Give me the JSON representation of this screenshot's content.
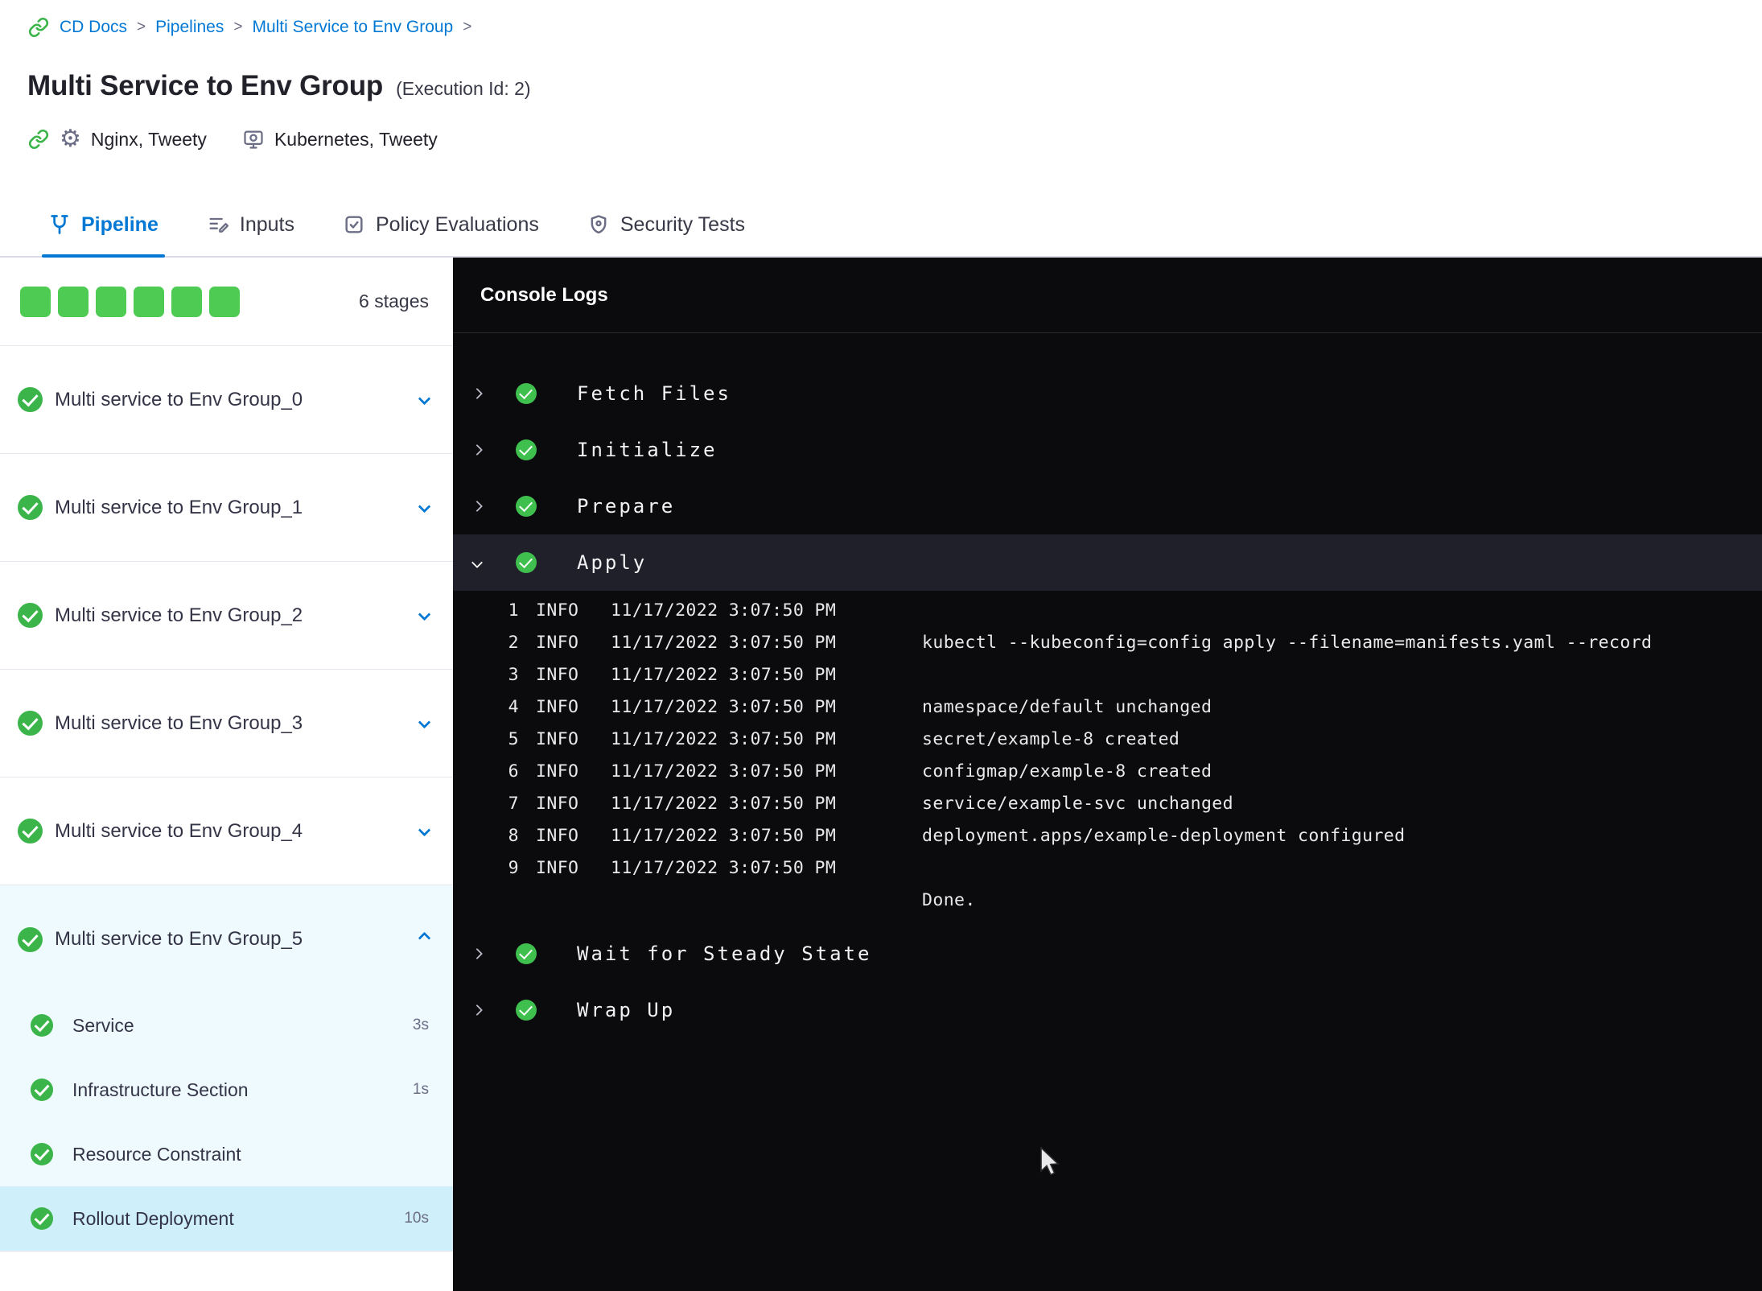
{
  "colors": {
    "accent_blue": "#0278d5",
    "success_green": "#3bb54a",
    "square_green": "#4ecb52",
    "console_bg": "#0b0b0d",
    "selected_step_bg": "#cfeffb",
    "expanded_group_bg": "#effaff"
  },
  "breadcrumb": {
    "separator": ">",
    "items": [
      {
        "label": "CD Docs"
      },
      {
        "label": "Pipelines"
      },
      {
        "label": "Multi Service to Env Group"
      }
    ]
  },
  "header": {
    "title": "Multi Service to Env Group",
    "execution_id": "(Execution Id: 2)",
    "services": "Nginx, Tweety",
    "environments": "Kubernetes, Tweety",
    "gear_glyph": "⚙"
  },
  "tabs": [
    {
      "label": "Pipeline",
      "icon": "pipeline-icon",
      "active": true
    },
    {
      "label": "Inputs",
      "icon": "inputs-icon",
      "active": false
    },
    {
      "label": "Policy Evaluations",
      "icon": "policy-icon",
      "active": false
    },
    {
      "label": "Security Tests",
      "icon": "security-icon",
      "active": false
    }
  ],
  "sidebar": {
    "stage_square_count": 6,
    "stage_count_label": "6 stages",
    "stages": [
      {
        "label": "Multi service to Env Group_0",
        "status": "success",
        "expanded": false
      },
      {
        "label": "Multi service to Env Group_1",
        "status": "success",
        "expanded": false
      },
      {
        "label": "Multi service to Env Group_2",
        "status": "success",
        "expanded": false
      },
      {
        "label": "Multi service to Env Group_3",
        "status": "success",
        "expanded": false
      },
      {
        "label": "Multi service to Env Group_4",
        "status": "success",
        "expanded": false
      },
      {
        "label": "Multi service to Env Group_5",
        "status": "success",
        "expanded": true,
        "steps": [
          {
            "label": "Service",
            "duration": "3s",
            "status": "success",
            "selected": false
          },
          {
            "label": "Infrastructure Section",
            "duration": "1s",
            "status": "success",
            "selected": false
          },
          {
            "label": "Resource Constraint",
            "duration": "",
            "status": "success",
            "selected": false
          },
          {
            "label": "Rollout Deployment",
            "duration": "10s",
            "status": "success",
            "selected": true
          }
        ]
      }
    ]
  },
  "console": {
    "title": "Console Logs",
    "steps": [
      {
        "label": "Fetch Files",
        "status": "success",
        "expanded": false
      },
      {
        "label": "Initialize",
        "status": "success",
        "expanded": false
      },
      {
        "label": "Prepare",
        "status": "success",
        "expanded": false
      },
      {
        "label": "Apply",
        "status": "success",
        "expanded": true,
        "logs": [
          {
            "num": "1",
            "level": "INFO",
            "time": "11/17/2022 3:07:50 PM",
            "msg": ""
          },
          {
            "num": "2",
            "level": "INFO",
            "time": "11/17/2022 3:07:50 PM",
            "msg": "kubectl --kubeconfig=config apply --filename=manifests.yaml --record"
          },
          {
            "num": "3",
            "level": "INFO",
            "time": "11/17/2022 3:07:50 PM",
            "msg": ""
          },
          {
            "num": "4",
            "level": "INFO",
            "time": "11/17/2022 3:07:50 PM",
            "msg": "namespace/default unchanged"
          },
          {
            "num": "5",
            "level": "INFO",
            "time": "11/17/2022 3:07:50 PM",
            "msg": "secret/example-8 created"
          },
          {
            "num": "6",
            "level": "INFO",
            "time": "11/17/2022 3:07:50 PM",
            "msg": "configmap/example-8 created"
          },
          {
            "num": "7",
            "level": "INFO",
            "time": "11/17/2022 3:07:50 PM",
            "msg": "service/example-svc unchanged"
          },
          {
            "num": "8",
            "level": "INFO",
            "time": "11/17/2022 3:07:50 PM",
            "msg": "deployment.apps/example-deployment configured"
          },
          {
            "num": "9",
            "level": "INFO",
            "time": "11/17/2022 3:07:50 PM",
            "msg": ""
          },
          {
            "num": "",
            "level": "",
            "time": "",
            "msg": "Done."
          }
        ]
      },
      {
        "label": "Wait for Steady State",
        "status": "success",
        "expanded": false
      },
      {
        "label": "Wrap Up",
        "status": "success",
        "expanded": false
      }
    ]
  }
}
